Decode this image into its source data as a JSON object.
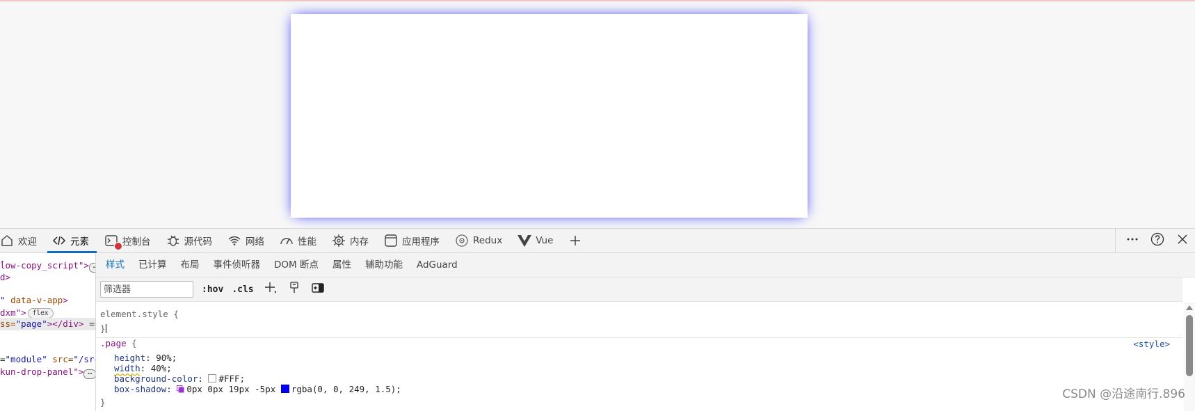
{
  "devtools": {
    "tabs": [
      {
        "label": "欢迎",
        "icon": "home-icon",
        "active": false
      },
      {
        "label": "元素",
        "icon": "code-icon",
        "active": true
      },
      {
        "label": "控制台",
        "icon": "console-icon",
        "active": false
      },
      {
        "label": "源代码",
        "icon": "bug-icon",
        "active": false
      },
      {
        "label": "网络",
        "icon": "wifi-icon",
        "active": false
      },
      {
        "label": "性能",
        "icon": "gauge-icon",
        "active": false
      },
      {
        "label": "内存",
        "icon": "chip-icon",
        "active": false
      },
      {
        "label": "应用程序",
        "icon": "app-icon",
        "active": false
      },
      {
        "label": "Redux",
        "icon": "redux-icon",
        "active": false
      },
      {
        "label": "Vue",
        "icon": "vue-icon",
        "active": false
      }
    ],
    "add_tab_icon": "plus-icon",
    "right_icons": [
      "more-icon",
      "help-icon",
      "close-icon"
    ],
    "error_badge_color": "#d13438",
    "accent_color": "#0f6cbd"
  },
  "elements_panel": {
    "lines": [
      {
        "parts": [
          {
            "t": ".",
            "c": "plain"
          }
        ]
      },
      {
        "parts": [
          {
            "t": "low-copy_script\">",
            "c": "tag"
          },
          {
            "t": "…",
            "c": "more"
          }
        ]
      },
      {
        "parts": [
          {
            "t": "d>",
            "c": "tag"
          }
        ]
      },
      {
        "parts": []
      },
      {
        "parts": [
          {
            "t": "\" ",
            "c": "val"
          },
          {
            "t": "data-v-app",
            "c": "attr"
          },
          {
            "t": ">",
            "c": "tag"
          }
        ]
      },
      {
        "parts": [
          {
            "t": "dxm\">",
            "c": "tag"
          },
          {
            "t": "flex",
            "c": "badge"
          }
        ]
      },
      {
        "parts": [
          {
            "t": "ss=",
            "c": "attr"
          },
          {
            "t": "\"page\"",
            "c": "val"
          },
          {
            "t": "></div>",
            "c": "tag"
          },
          {
            "t": " ==",
            "c": "plain"
          }
        ],
        "selected": true
      },
      {
        "parts": []
      },
      {
        "parts": []
      },
      {
        "parts": [
          {
            "t": "=",
            "c": "plain"
          },
          {
            "t": "\"module\" ",
            "c": "val"
          },
          {
            "t": "src=",
            "c": "attr"
          },
          {
            "t": "\"/src",
            "c": "val"
          }
        ]
      },
      {
        "parts": [
          {
            "t": "kun-drop-panel\">",
            "c": "tag"
          },
          {
            "t": "…",
            "c": "more"
          }
        ]
      }
    ]
  },
  "styles_panel": {
    "subtabs": [
      "样式",
      "已计算",
      "布局",
      "事件侦听器",
      "DOM 断点",
      "属性",
      "辅助功能",
      "AdGuard"
    ],
    "active_subtab": 0,
    "filter": {
      "placeholder": "筛选器",
      "value": ""
    },
    "buttons": {
      "hov": ":hov",
      "cls": ".cls"
    },
    "toolbar_icons": [
      "new-rule-icon",
      "paint-icon",
      "sidebar-toggle-icon"
    ],
    "element_style": {
      "open": "element.style {",
      "close": "}"
    },
    "page_rule": {
      "selector": ".page",
      "open_brace": " {",
      "close": "}",
      "source": "<style>",
      "declarations": [
        {
          "name": "height",
          "value": "90%;"
        },
        {
          "name": "width",
          "value": "40%;"
        },
        {
          "name": "background-color",
          "value": "#FFF;",
          "swatch": "#ffffff"
        },
        {
          "name": "box-shadow",
          "value": "0px 0px 19px -5px ",
          "color_text": "rgba(0, 0, 249, 1.5);",
          "swatch": "#0000f9"
        }
      ]
    }
  },
  "watermark": "CSDN @沿途南行.896"
}
